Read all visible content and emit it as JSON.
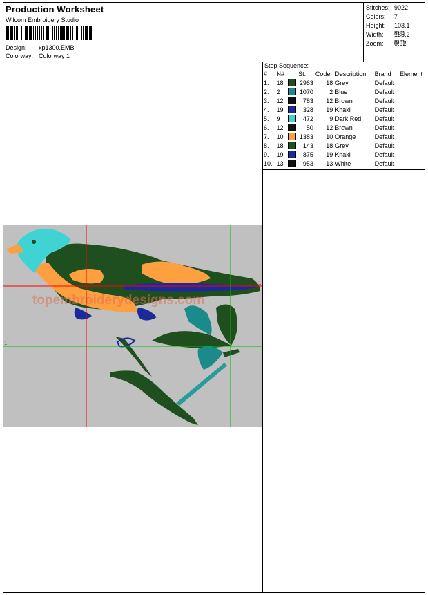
{
  "header": {
    "title": "Production Worksheet",
    "software": "Wilcom Embroidery Studio",
    "design_label": "Design:",
    "design_value": "xp1300.EMB",
    "colorway_label": "Colorway:",
    "colorway_value": "Colorway 1"
  },
  "stats": [
    {
      "label": "Stitches:",
      "value": "9022"
    },
    {
      "label": "Colors:",
      "value": "7"
    },
    {
      "label": "Height:",
      "value": "103.1 mm"
    },
    {
      "label": "Width:",
      "value": "135.2 mm"
    },
    {
      "label": "Zoom:",
      "value": "0.92"
    }
  ],
  "stop_sequence": {
    "title": "Stop Sequence:",
    "columns": [
      "#",
      "N#",
      "St.",
      "Code",
      "Description",
      "Brand",
      "Element"
    ],
    "rows": [
      {
        "num": "1.",
        "n": "18",
        "color": "#1f4f1f",
        "st": "2963",
        "code": "18",
        "desc": "Grey",
        "brand": "Default"
      },
      {
        "num": "2.",
        "n": "2",
        "color": "#1a8a8a",
        "st": "1070",
        "code": "2",
        "desc": "Blue",
        "brand": "Default"
      },
      {
        "num": "3.",
        "n": "12",
        "color": "#111111",
        "st": "783",
        "code": "12",
        "desc": "Brown",
        "brand": "Default"
      },
      {
        "num": "4.",
        "n": "19",
        "color": "#1a2a9a",
        "st": "328",
        "code": "19",
        "desc": "Khaki",
        "brand": "Default"
      },
      {
        "num": "5.",
        "n": "9",
        "color": "#3fd3d3",
        "st": "472",
        "code": "9",
        "desc": "Dark Red",
        "brand": "Default"
      },
      {
        "num": "6.",
        "n": "12",
        "color": "#111111",
        "st": "50",
        "code": "12",
        "desc": "Brown",
        "brand": "Default"
      },
      {
        "num": "7.",
        "n": "10",
        "color": "#ffa040",
        "st": "1383",
        "code": "10",
        "desc": "Orange",
        "brand": "Default"
      },
      {
        "num": "8.",
        "n": "18",
        "color": "#1f4f1f",
        "st": "143",
        "code": "18",
        "desc": "Grey",
        "brand": "Default"
      },
      {
        "num": "9.",
        "n": "19",
        "color": "#1a2a9a",
        "st": "875",
        "code": "19",
        "desc": "Khaki",
        "brand": "Default"
      },
      {
        "num": "10.",
        "n": "13",
        "color": "#111111",
        "st": "953",
        "code": "13",
        "desc": "White",
        "brand": "Default"
      }
    ]
  },
  "design": {
    "watermark": "topembroiderydesigns.com",
    "axis_label_x": "1",
    "axis_label_y": "1"
  }
}
